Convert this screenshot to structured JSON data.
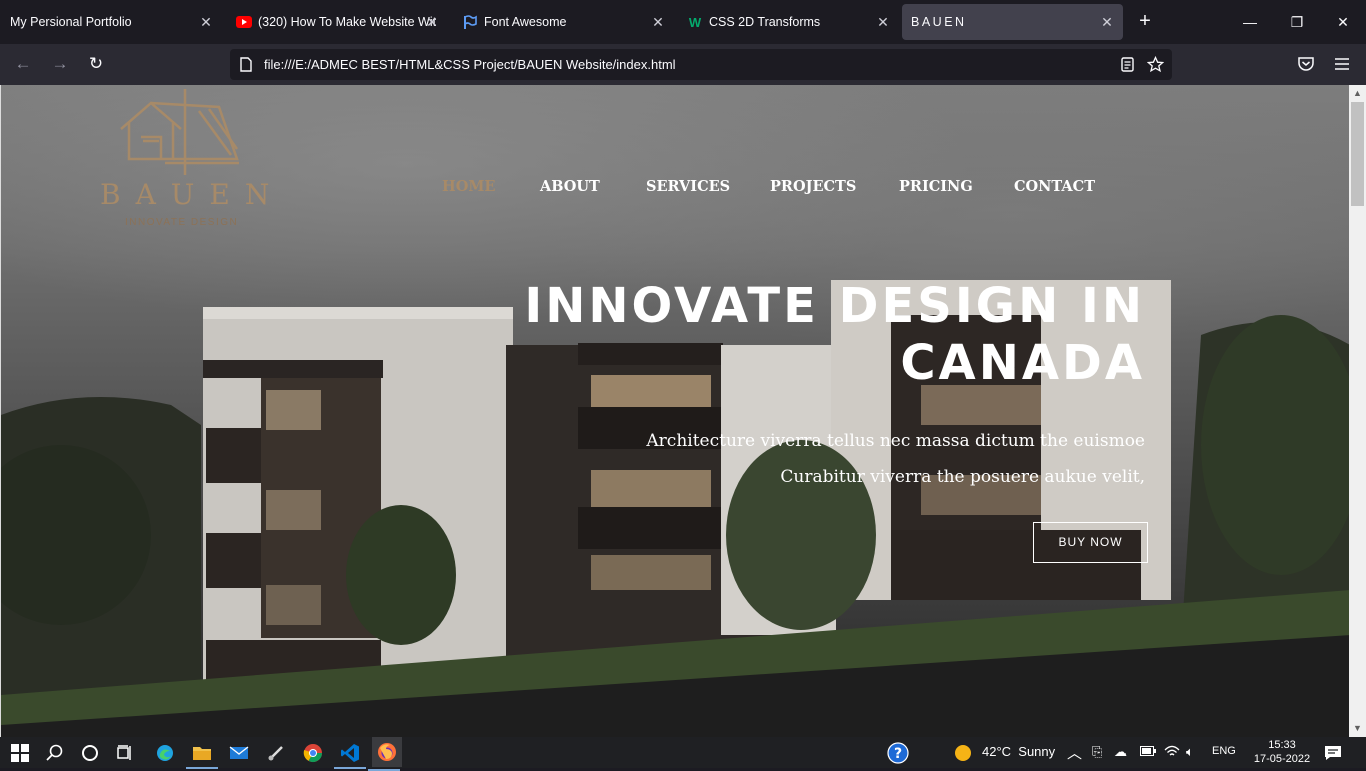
{
  "tabs": [
    {
      "label": "My Persional Portfolio",
      "icon": "none"
    },
    {
      "label": "(320) How To Make Website Wit",
      "icon": "youtube-icon"
    },
    {
      "label": "Font Awesome",
      "icon": "flag-icon"
    },
    {
      "label": "CSS 2D Transforms",
      "icon": "w3schools-icon"
    },
    {
      "label": "BAUEN",
      "icon": "none",
      "active": true
    }
  ],
  "url": "file:///E:/ADMEC BEST/HTML&CSS Project/BAUEN Website/index.html",
  "site": {
    "logo_title": "BAUEN",
    "logo_subtitle": "INNOVATE DESIGN",
    "menu": [
      "HOME",
      "ABOUT",
      "SERVICES",
      "PROJECTS",
      "PRICING",
      "CONTACT"
    ],
    "hero_title_line1": "INNOVATE DESIGN IN",
    "hero_title_line2": "CANADA",
    "hero_text_line1": "Architecture viverra tellus nec massa dictum the euismoe",
    "hero_text_line2": "Curabitur viverra the posuere aukue velit,",
    "cta": "BUY NOW",
    "accent_color": "#a78a68"
  },
  "taskbar": {
    "weather": "42°C  Sunny",
    "language": "ENG",
    "time": "15:33",
    "date": "17-05-2022"
  }
}
